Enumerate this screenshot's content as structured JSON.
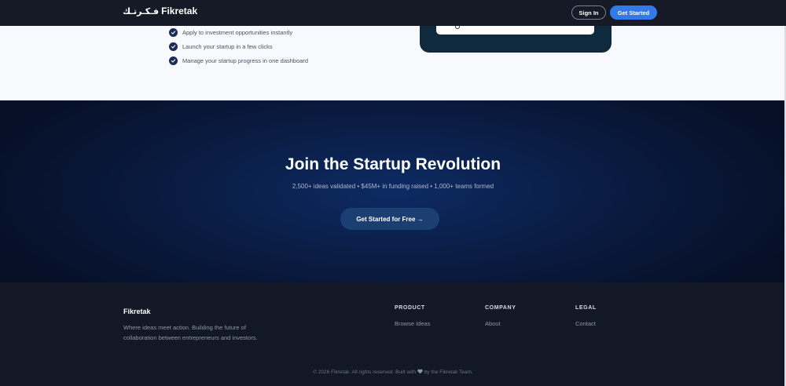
{
  "header": {
    "logo_arabic": "فـكـرتـك",
    "logo_text": "Fikretak",
    "signin_label": "Sign In",
    "get_started_label": "Get Started"
  },
  "features": {
    "items": [
      {
        "label": "Apply to investment opportunities instantly"
      },
      {
        "label": "Launch your startup in a few clicks"
      },
      {
        "label": "Manage your startup progress in one dashboard"
      }
    ]
  },
  "cta": {
    "title": "Join the Startup Revolution",
    "subtitle": "2,500+ ideas validated • $45M+ in funding raised • 1,000+ teams formed",
    "button_label": "Get Started for Free →"
  },
  "footer": {
    "brand": "Fikretak",
    "description": "Where ideas meet action. Building the future of collaboration between entrepreneurs and investors.",
    "columns": [
      {
        "title": "PRODUCT",
        "links": [
          {
            "label": "Browse Ideas"
          }
        ]
      },
      {
        "title": "COMPANY",
        "links": [
          {
            "label": "About"
          }
        ]
      },
      {
        "title": "LEGAL",
        "links": [
          {
            "label": "Contact"
          }
        ]
      }
    ],
    "copyright_prefix": "© 2026 Fikretak. All rights reserved. Built with",
    "copyright_suffix": "by the Fikretak Team."
  },
  "colors": {
    "accent": "#3479ea",
    "header_bg": "#151a26",
    "cta_bg": "#0a1d45",
    "footer_bg": "#121826",
    "check_bg": "#1b2b57"
  },
  "icons": [
    "check-icon",
    "heart-icon",
    "arrow-right-icon"
  ]
}
